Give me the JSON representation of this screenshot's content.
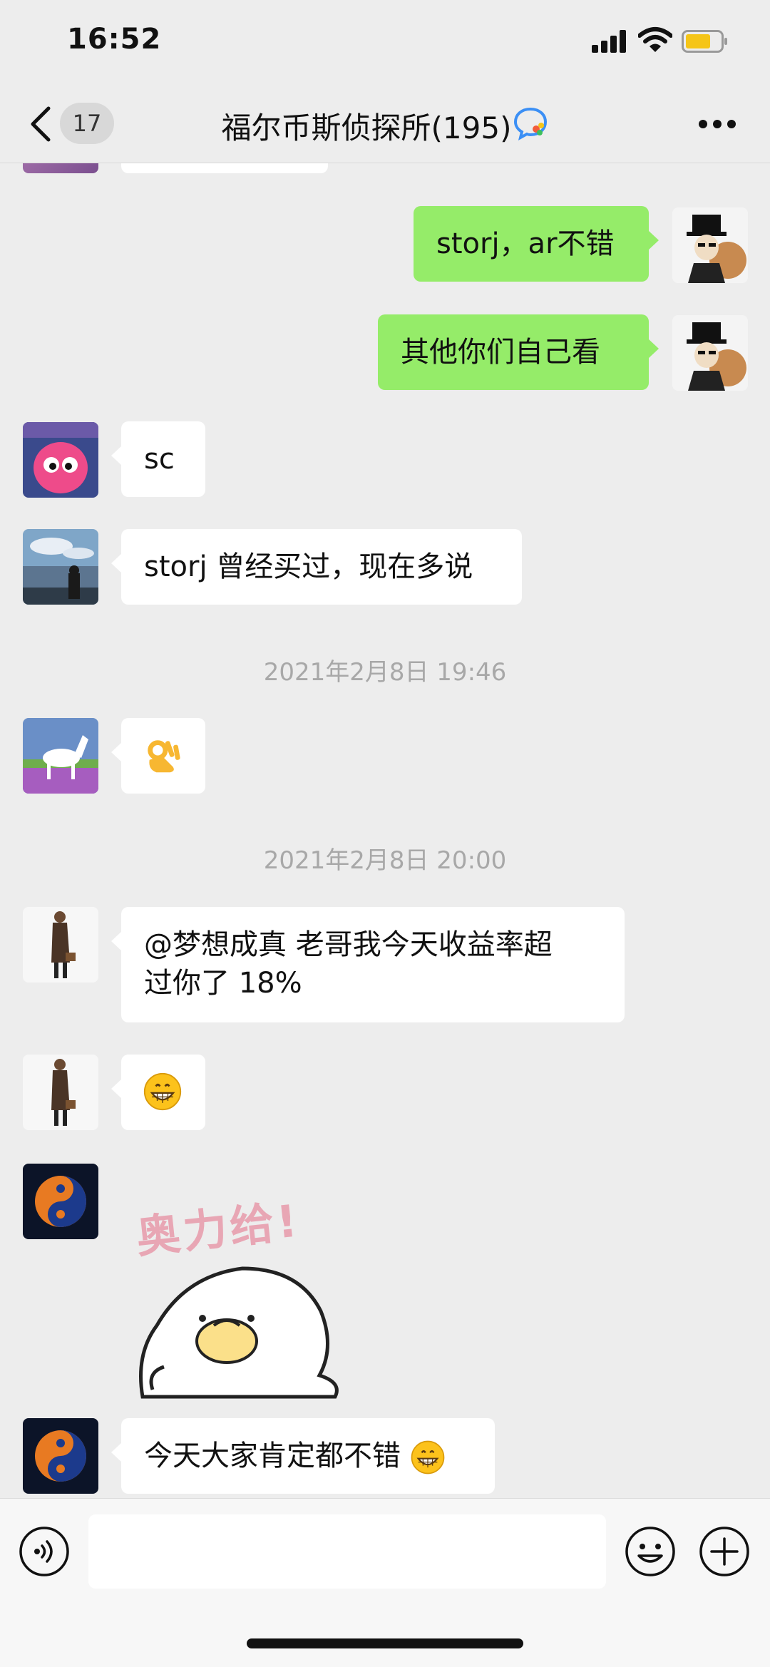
{
  "status_bar": {
    "time": "16:52"
  },
  "nav": {
    "unread_count": "17",
    "title": "福尔币斯侦探所(195)"
  },
  "messages": {
    "m1": "storj，ar不错",
    "m2": "其他你们自己看",
    "m3": "sc",
    "m4": "storj 曾经买过，现在多说",
    "ts1": "2021年2月8日 19:46",
    "ts2": "2021年2月8日 20:00",
    "m6_line1": "@梦想成真 老哥我今天收益率超",
    "m6_line2": "过你了 18%",
    "sticker_text": "奥力给!",
    "m9": "今天大家肯定都不错"
  },
  "colors": {
    "background": "#ededed",
    "sent_bubble": "#95ec69",
    "received_bubble": "#ffffff",
    "timestamp": "#a8a8a8"
  },
  "input_bar": {
    "input_value": ""
  }
}
